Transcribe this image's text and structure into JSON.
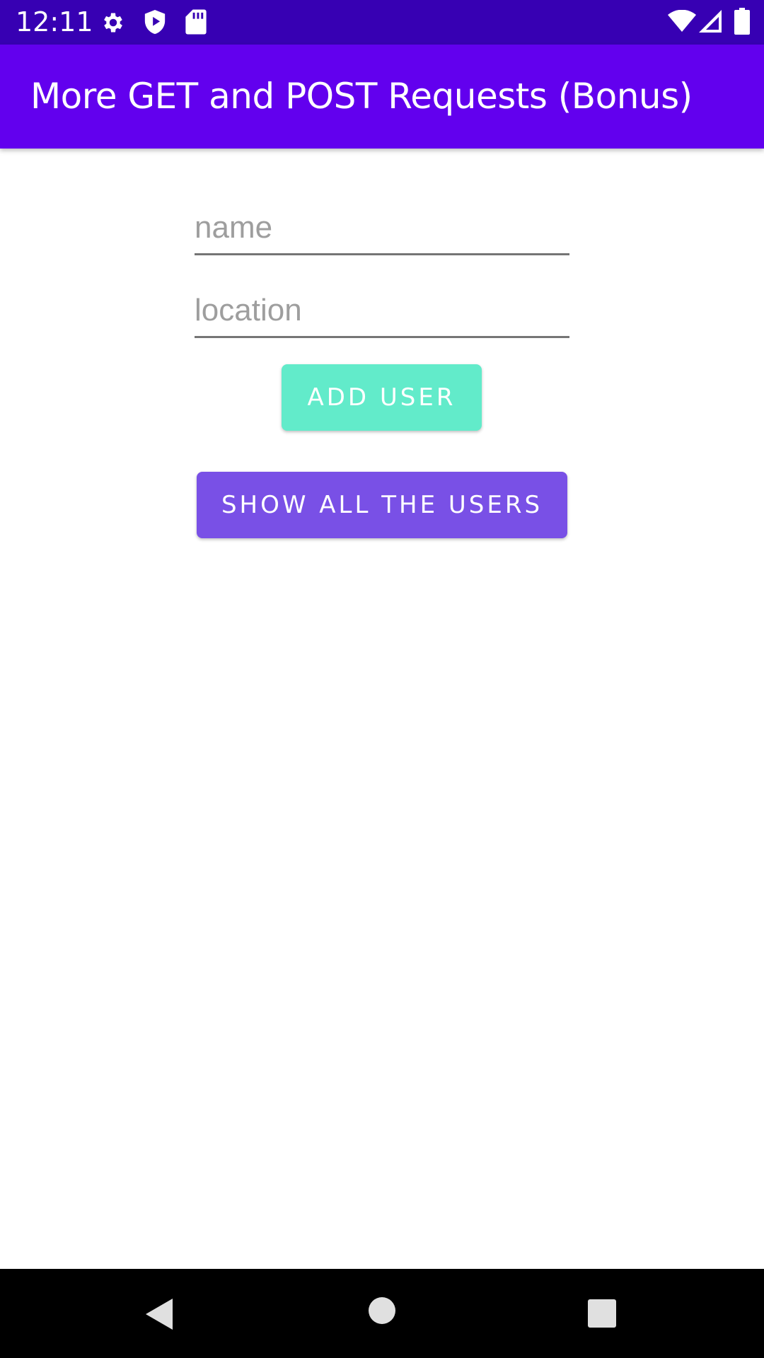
{
  "status_bar": {
    "time": "12:11",
    "icons": [
      "gear-icon",
      "shield-icon",
      "sdcard-icon",
      "wifi-icon",
      "signal-icon",
      "battery-icon"
    ]
  },
  "app_bar": {
    "title": "More GET and POST Requests (Bonus)"
  },
  "form": {
    "name_placeholder": "name",
    "name_value": "",
    "location_placeholder": "location",
    "location_value": "",
    "add_user_label": "ADD USER",
    "show_users_label": "SHOW ALL THE USERS"
  },
  "nav_bar": {
    "icons": [
      "back-icon",
      "home-icon",
      "recents-icon"
    ]
  },
  "colors": {
    "status_bar": "#3700b3",
    "app_bar": "#6200ee",
    "add_button": "#62ebca",
    "show_button": "#7950e6"
  }
}
